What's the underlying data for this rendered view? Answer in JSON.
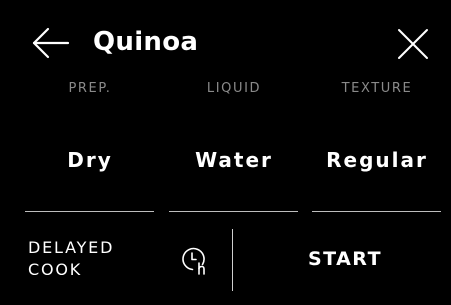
{
  "header": {
    "title": "Quinoa",
    "back_icon": "arrow-left-icon",
    "close_icon": "close-icon"
  },
  "options": [
    {
      "label": "PREP.",
      "value": "Dry"
    },
    {
      "label": "LIQUID",
      "value": "Water"
    },
    {
      "label": "TEXTURE",
      "value": "Regular"
    }
  ],
  "footer": {
    "delayed_cook_line1": "DELAYED",
    "delayed_cook_line2": "COOK",
    "delay_icon": "clock-hours-icon",
    "start_label": "START"
  },
  "colors": {
    "background": "#000000",
    "text": "#ffffff",
    "label": "#8a8a8a",
    "underline": "#bdbdbd"
  }
}
